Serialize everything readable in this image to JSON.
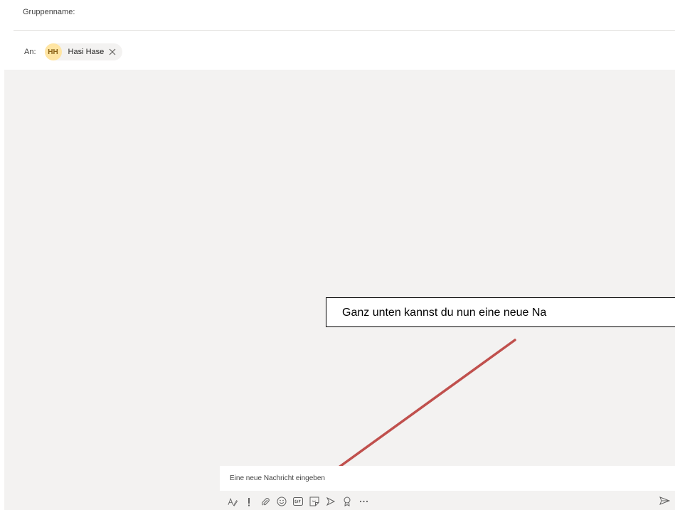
{
  "header": {
    "group_name_label": "Gruppenname:",
    "to_label": "An:",
    "recipients": [
      {
        "initials": "HH",
        "name": "Hasi Hase",
        "avatar_color": "#ffe5a3"
      }
    ]
  },
  "annotation": {
    "text": "Ganz unten kannst du nun eine neue Na",
    "arrow_color": "#c0504d"
  },
  "compose": {
    "placeholder": "Eine neue Nachricht eingeben",
    "value": ""
  },
  "toolbar": {
    "icons": [
      "format-icon",
      "important-icon",
      "attach-icon",
      "emoji-icon",
      "gif-icon",
      "sticker-icon",
      "meet-icon",
      "praise-icon",
      "more-icon"
    ],
    "send_icon": "send-icon"
  },
  "colors": {
    "conversation_bg": "#f3f2f1",
    "chip_bg": "#f3f2f1",
    "icon": "#616161"
  }
}
